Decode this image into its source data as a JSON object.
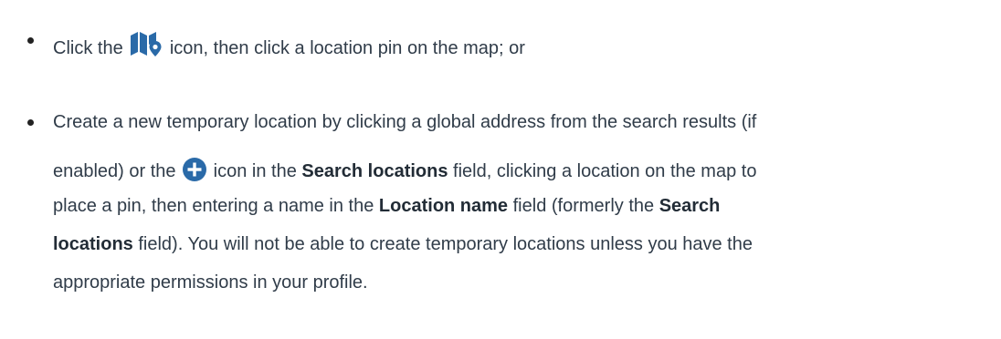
{
  "bullets": [
    {
      "text_before_icon": "Click the",
      "icon": "map-pin-icon",
      "text_after_icon": "icon, then click a location pin on the map; or"
    },
    {
      "line1": "Create a new temporary location by clicking a global address from the search results (if",
      "line2_before_icon": "enabled) or the",
      "icon": "plus-circle-icon",
      "line2_mid1": "icon in the",
      "line2_bold1": "Search locations",
      "line2_after": "field, clicking a location on the map to",
      "line3_before": "place a pin, then entering a name in the",
      "line3_bold1": "Location name",
      "line3_mid": "field (formerly the",
      "line3_bold2": "Search",
      "line4_bold": "locations",
      "line4_after": "field). You will not be able to create temporary locations unless you have the",
      "line5": "appropriate permissions in your profile."
    }
  ],
  "colors": {
    "text": "#303c49",
    "icon": "#2a6aa8"
  }
}
